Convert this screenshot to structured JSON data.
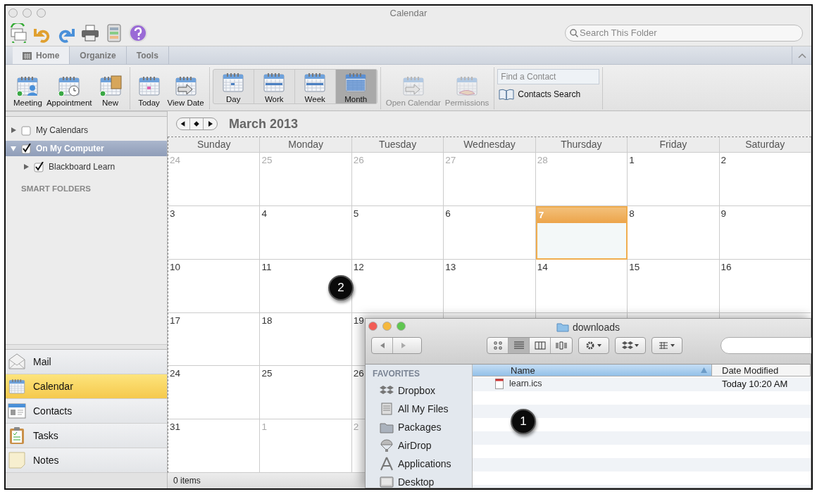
{
  "window": {
    "title": "Calendar"
  },
  "toolbar": {
    "search": {
      "placeholder": "Search This Folder"
    }
  },
  "tabs": [
    {
      "label": "Home",
      "selected": true
    },
    {
      "label": "Organize",
      "selected": false
    },
    {
      "label": "Tools",
      "selected": false
    }
  ],
  "ribbon": [
    {
      "kind": "actions",
      "buttons": [
        {
          "label": "Meeting",
          "kind": "meeting"
        },
        {
          "label": "Appointment",
          "kind": "appointment"
        },
        {
          "label": "New",
          "kind": "new"
        }
      ]
    },
    {
      "kind": "actions",
      "buttons": [
        {
          "label": "Today",
          "kind": "today"
        },
        {
          "label": "View Date",
          "kind": "viewdate"
        }
      ]
    },
    {
      "kind": "views",
      "buttons": [
        {
          "label": "Day",
          "kind": "day",
          "selected": false
        },
        {
          "label": "Work",
          "kind": "work",
          "selected": false
        },
        {
          "label": "Week",
          "kind": "week",
          "selected": false
        },
        {
          "label": "Month",
          "kind": "month",
          "selected": true
        }
      ]
    },
    {
      "kind": "actions",
      "disabled": true,
      "buttons": [
        {
          "label": "Open Calendar",
          "kind": "open"
        },
        {
          "label": "Permissions",
          "kind": "permissions"
        }
      ]
    },
    {
      "kind": "contacts",
      "find_placeholder": "Find a Contact",
      "search_label": "Contacts Search"
    }
  ],
  "folders": [
    {
      "label": "My Calendars",
      "checked": false,
      "expanded": false,
      "selected": false
    },
    {
      "label": "On My Computer",
      "checked": true,
      "expanded": true,
      "selected": true,
      "children": [
        {
          "label": "Blackboard Learn",
          "checked": true,
          "expanded": false,
          "selected": false
        }
      ]
    }
  ],
  "smart_folders_heading": "SMART FOLDERS",
  "nav": [
    {
      "label": "Mail",
      "kind": "mail",
      "selected": false
    },
    {
      "label": "Calendar",
      "kind": "calendar",
      "selected": true
    },
    {
      "label": "Contacts",
      "kind": "contacts",
      "selected": false
    },
    {
      "label": "Tasks",
      "kind": "tasks",
      "selected": false
    },
    {
      "label": "Notes",
      "kind": "notes",
      "selected": false
    }
  ],
  "calendar": {
    "title": "March 2013",
    "weekdays": [
      "Sunday",
      "Monday",
      "Tuesday",
      "Wednesday",
      "Thursday",
      "Friday",
      "Saturday"
    ],
    "weeks": [
      [
        {
          "day": "24",
          "in_month": false,
          "today": false
        },
        {
          "day": "25",
          "in_month": false,
          "today": false
        },
        {
          "day": "26",
          "in_month": false,
          "today": false
        },
        {
          "day": "27",
          "in_month": false,
          "today": false
        },
        {
          "day": "28",
          "in_month": false,
          "today": false
        },
        {
          "day": "1",
          "in_month": true,
          "today": false
        },
        {
          "day": "2",
          "in_month": true,
          "today": false
        }
      ],
      [
        {
          "day": "3",
          "in_month": true,
          "today": false
        },
        {
          "day": "4",
          "in_month": true,
          "today": false
        },
        {
          "day": "5",
          "in_month": true,
          "today": false
        },
        {
          "day": "6",
          "in_month": true,
          "today": false
        },
        {
          "day": "7",
          "in_month": true,
          "today": true
        },
        {
          "day": "8",
          "in_month": true,
          "today": false
        },
        {
          "day": "9",
          "in_month": true,
          "today": false
        }
      ],
      [
        {
          "day": "10",
          "in_month": true,
          "today": false
        },
        {
          "day": "11",
          "in_month": true,
          "today": false
        },
        {
          "day": "12",
          "in_month": true,
          "today": false
        },
        {
          "day": "13",
          "in_month": true,
          "today": false
        },
        {
          "day": "14",
          "in_month": true,
          "today": false
        },
        {
          "day": "15",
          "in_month": true,
          "today": false
        },
        {
          "day": "16",
          "in_month": true,
          "today": false
        }
      ],
      [
        {
          "day": "17",
          "in_month": true,
          "today": false
        },
        {
          "day": "18",
          "in_month": true,
          "today": false
        },
        {
          "day": "19",
          "in_month": true,
          "today": false
        }
      ],
      [
        {
          "day": "24",
          "in_month": true,
          "today": false
        },
        {
          "day": "25",
          "in_month": true,
          "today": false
        },
        {
          "day": "26",
          "in_month": true,
          "today": false
        }
      ],
      [
        {
          "day": "31",
          "in_month": true,
          "today": false
        },
        {
          "day": "1",
          "in_month": false,
          "today": false
        },
        {
          "day": "2",
          "in_month": false,
          "today": false
        }
      ]
    ]
  },
  "status_bar": "0 items",
  "finder": {
    "title": "downloads",
    "view_modes": [
      {
        "kind": "icons",
        "selected": false
      },
      {
        "kind": "list",
        "selected": true
      },
      {
        "kind": "columns",
        "selected": false
      },
      {
        "kind": "coverflow",
        "selected": false
      }
    ],
    "sidebar_heading": "FAVORITES",
    "favorites": [
      {
        "label": "Dropbox",
        "kind": "dropbox"
      },
      {
        "label": "All My Files",
        "kind": "files"
      },
      {
        "label": "Packages",
        "kind": "folder"
      },
      {
        "label": "AirDrop",
        "kind": "airdrop"
      },
      {
        "label": "Applications",
        "kind": "apps"
      },
      {
        "label": "Desktop",
        "kind": "desktop"
      }
    ],
    "columns": [
      "Name",
      "Date Modified"
    ],
    "files": [
      {
        "name": "learn.ics",
        "modified": "Today 10:20 AM"
      }
    ]
  },
  "callouts": [
    {
      "label": "2"
    },
    {
      "label": "1"
    }
  ]
}
